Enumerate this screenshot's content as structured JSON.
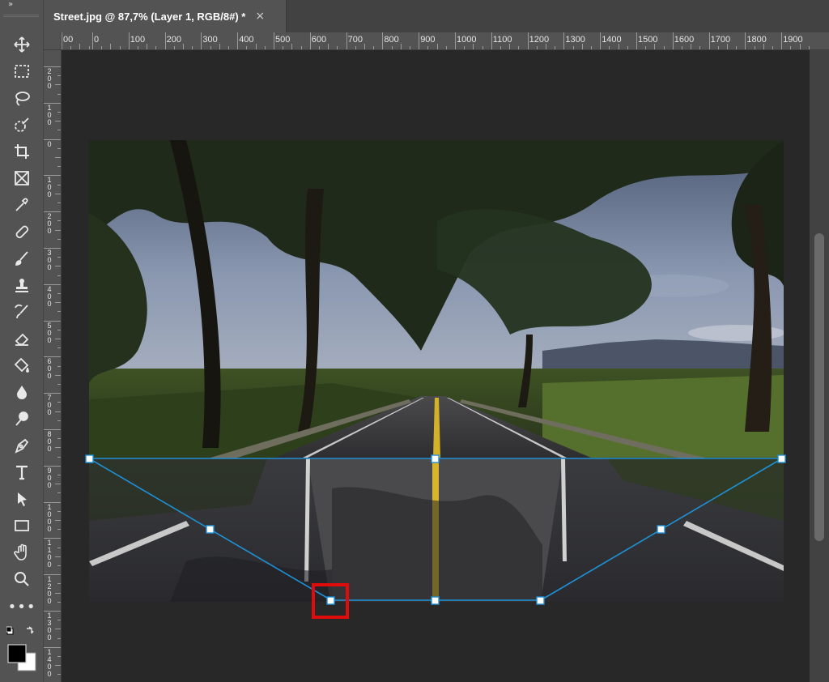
{
  "document": {
    "tab_title": "Street.jpg @ 87,7% (Layer 1, RGB/8#) *",
    "close_glyph": "×"
  },
  "toolbar": {
    "collapse_glyph": "»",
    "more_glyph": "•••",
    "tools": [
      {
        "name": "move-tool-icon"
      },
      {
        "name": "rectangular-marquee-icon"
      },
      {
        "name": "lasso-icon"
      },
      {
        "name": "quick-selection-icon"
      },
      {
        "name": "crop-icon"
      },
      {
        "name": "frame-icon"
      },
      {
        "name": "eyedropper-icon"
      },
      {
        "name": "healing-brush-icon"
      },
      {
        "name": "brush-icon"
      },
      {
        "name": "clone-stamp-icon"
      },
      {
        "name": "history-brush-icon"
      },
      {
        "name": "eraser-icon"
      },
      {
        "name": "paint-bucket-icon"
      },
      {
        "name": "blur-icon"
      },
      {
        "name": "dodge-icon"
      },
      {
        "name": "pen-icon"
      },
      {
        "name": "type-icon"
      },
      {
        "name": "path-selection-icon"
      },
      {
        "name": "rectangle-shape-icon"
      },
      {
        "name": "hand-icon"
      },
      {
        "name": "zoom-icon"
      }
    ],
    "foreground_color": "#000000",
    "background_color": "#ffffff"
  },
  "rulers": {
    "horizontal_labels": [
      "00",
      "0",
      "100",
      "200",
      "300",
      "400",
      "500",
      "600",
      "700",
      "800",
      "900",
      "1000",
      "1100",
      "1200",
      "1300",
      "1400",
      "1500",
      "1600",
      "1700",
      "1800",
      "1900"
    ],
    "vertical_labels": [
      "2\n0\n0",
      "1\n0\n0",
      "0",
      "1\n0\n0",
      "2\n0\n0",
      "3\n0\n0",
      "4\n0\n0",
      "5\n0\n0",
      "6\n0\n0",
      "7\n0\n0",
      "8\n0\n0",
      "9\n0\n0",
      "1\n0\n0\n0",
      "1\n1\n0\n0",
      "1\n2\n0\n0",
      "1\n3\n0\n0",
      "1\n4\n0\n0"
    ]
  },
  "transform": {
    "line_color": "#1e90d6",
    "handle_fill": "#ffffff",
    "highlight_color": "#e00b0b"
  }
}
